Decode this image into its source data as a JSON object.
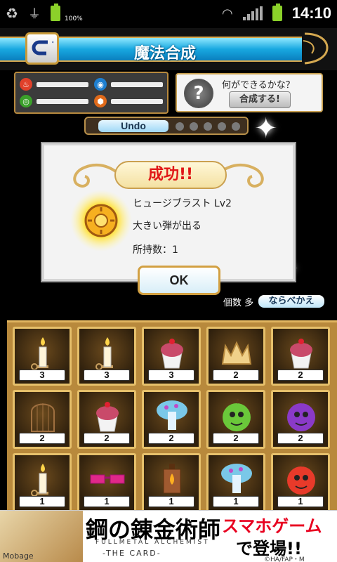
{
  "status_bar": {
    "battery_percent": "100%",
    "time": "14:10"
  },
  "header": {
    "title": "魔法合成"
  },
  "elements": {
    "bars": [
      {
        "icon": "fire-icon",
        "color": "#e0402a",
        "level": 0
      },
      {
        "icon": "water-icon",
        "color": "#1e7fd0",
        "level": 0
      },
      {
        "icon": "wind-icon",
        "color": "#3aa02a",
        "level": 0
      },
      {
        "icon": "earth-icon",
        "color": "#e06a1a",
        "level": 0
      }
    ]
  },
  "hint": {
    "text": "何ができるかな？",
    "button": "合成する!"
  },
  "undo": {
    "label": "Undo",
    "slots": 5
  },
  "dialog": {
    "banner": "成功!!",
    "item_name": "ヒュージブラスト Lv2",
    "description": "大きい弾が出る",
    "count": "所持数：1",
    "ok": "OK"
  },
  "sort": {
    "label": "個数 多",
    "button": "ならべかえ"
  },
  "inventory": [
    {
      "item": "candle-icon",
      "count": "3"
    },
    {
      "item": "candle-icon",
      "count": "3"
    },
    {
      "item": "cupcake-icon",
      "count": "3"
    },
    {
      "item": "crown-icon",
      "count": "2"
    },
    {
      "item": "cupcake-icon",
      "count": "2"
    },
    {
      "item": "birdcage-icon",
      "count": "2"
    },
    {
      "item": "cupcake-icon",
      "count": "2"
    },
    {
      "item": "mushroom-icon",
      "count": "2"
    },
    {
      "item": "apple-icon",
      "count": "2"
    },
    {
      "item": "apple-icon",
      "count": "2"
    },
    {
      "item": "candle-icon",
      "count": "1"
    },
    {
      "item": "glasses-icon",
      "count": "1"
    },
    {
      "item": "lantern-icon",
      "count": "1"
    },
    {
      "item": "mushroom-icon",
      "count": "1"
    },
    {
      "item": "apple-icon",
      "count": "1"
    }
  ],
  "ad": {
    "title": "鋼の錬金術師",
    "subtitle": "FULLMETAL ALCHEMIST",
    "the_card": "-THE CARD-",
    "promo_line1": "スマホゲーム",
    "promo_line2": "で登場!!",
    "copyright": "©HA/FAP・M",
    "mobage": "Mobage"
  }
}
